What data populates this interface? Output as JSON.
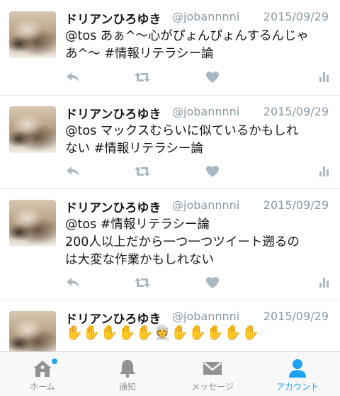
{
  "tweets": [
    {
      "name": "ドリアンひろゆき",
      "handle": "@jobannnni",
      "date": "2015/09/29",
      "lines": [
        "@tos あぁ^〜心がぴょんぴょんするんじゃ",
        "あ^〜 #情報リテラシー論"
      ]
    },
    {
      "name": "ドリアンひろゆき",
      "handle": "@jobannnni",
      "date": "2015/09/29",
      "lines": [
        "@tos マックスむらいに似ているかもしれ",
        "ない #情報リテラシー論"
      ]
    },
    {
      "name": "ドリアンひろゆき",
      "handle": "@jobannnni",
      "date": "2015/09/29",
      "lines": [
        "@tos #情報リテラシー論",
        "200人以上だから一つ一つツイート遡るの",
        "は大変な作業かもしれない"
      ]
    },
    {
      "name": "ドリアンひろゆき",
      "handle": "@jobannnni",
      "date": "2015/09/29",
      "lines": [
        "✋✋✋✋✋👳✋✋✋✋✋"
      ]
    }
  ],
  "tabs": [
    {
      "label": "ホーム",
      "icon": "home-icon",
      "active": false,
      "badge": true
    },
    {
      "label": "通知",
      "icon": "bell-icon",
      "active": false,
      "badge": false
    },
    {
      "label": "メッセージ",
      "icon": "envelope-icon",
      "active": false,
      "badge": false
    },
    {
      "label": "アカウント",
      "icon": "person-icon",
      "active": true,
      "badge": false
    }
  ],
  "colors": {
    "accent": "#1da1f2",
    "icon_gray": "#aab8c2",
    "tab_gray": "#929292"
  }
}
